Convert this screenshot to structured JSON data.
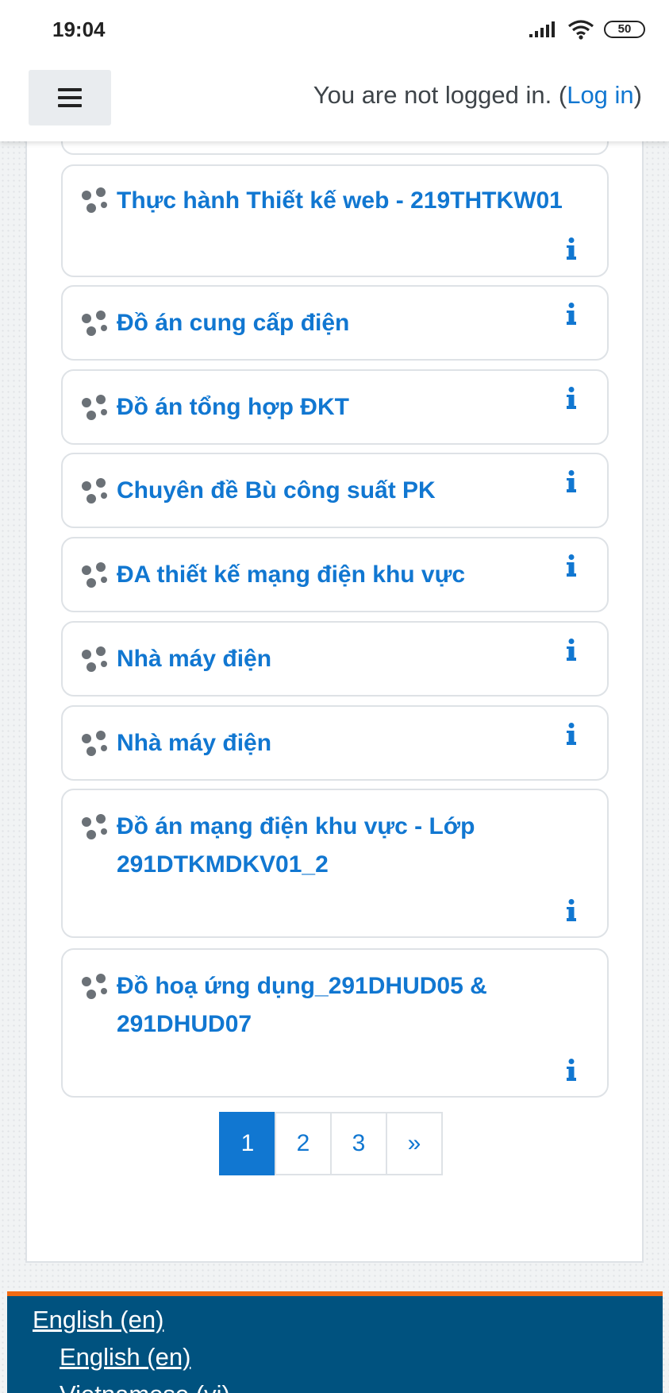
{
  "status_bar": {
    "time": "19:04",
    "battery": "50"
  },
  "header": {
    "login_prefix": "You are not logged in. (",
    "login_link": "Log in",
    "login_suffix": ")"
  },
  "courses": [
    {
      "title": "Thực hành Thiết kế web - 219THTKW01"
    },
    {
      "title": "Đồ án cung cấp điện"
    },
    {
      "title": "Đồ án tổng hợp ĐKT"
    },
    {
      "title": "Chuyên đề Bù công suất PK"
    },
    {
      "title": "ĐA thiết kế mạng điện khu vực"
    },
    {
      "title": "Nhà máy điện"
    },
    {
      "title": "Nhà máy điện"
    },
    {
      "title": "Đồ án mạng điện khu vực - Lớp 291DTKMDKV01_2"
    },
    {
      "title": "Đồ hoạ ứng dụng_291DHUD05 & 291DHUD07"
    }
  ],
  "pagination": {
    "pages": [
      "1",
      "2",
      "3",
      "»"
    ],
    "current": "1"
  },
  "footer": {
    "language_menu": "English (en)",
    "options": [
      "English (en)",
      "Vietnamese (vi)"
    ]
  },
  "colors": {
    "link": "#1177d1",
    "footer_bg": "#00527f",
    "footer_accent": "#f06a13"
  }
}
